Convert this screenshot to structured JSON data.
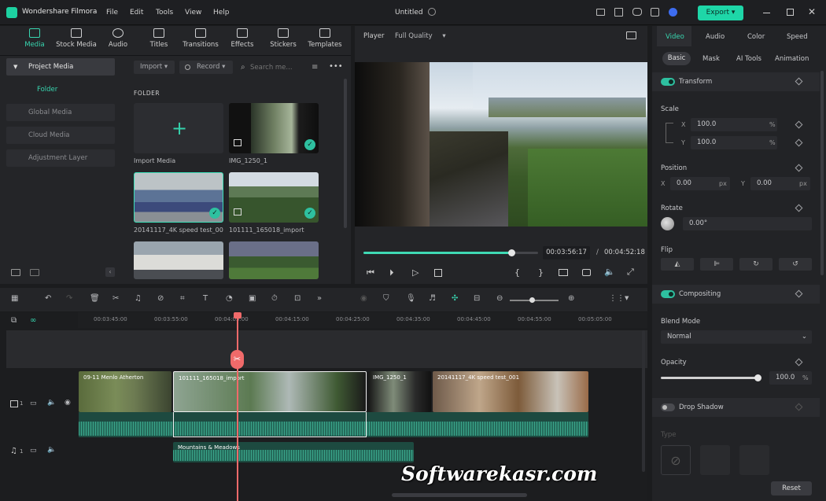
{
  "app": {
    "name": "Wondershare Filmora",
    "doc_title": "Untitled",
    "export_label": "Export",
    "menu": [
      "File",
      "Edit",
      "Tools",
      "View",
      "Help"
    ]
  },
  "toolbar": {
    "tabs": [
      "Media",
      "Stock Media",
      "Audio",
      "Titles",
      "Transitions",
      "Effects",
      "Stickers",
      "Templates"
    ]
  },
  "sidebar": {
    "items": [
      "Project Media",
      "Folder",
      "Global Media",
      "Cloud Media",
      "Adjustment Layer"
    ]
  },
  "media": {
    "import_label": "Import",
    "record_label": "Record",
    "search_placeholder": "Search me...",
    "folder_label": "FOLDER",
    "items": [
      "Import Media",
      "IMG_1250_1",
      "20141117_4K speed test_00...",
      "101111_165018_import"
    ]
  },
  "player": {
    "label": "Player",
    "quality": "Full Quality",
    "current_time": "00:03:56:17",
    "separator": "/",
    "total_time": "00:04:52:18",
    "progress": 0.85
  },
  "props": {
    "tabs": [
      "Video",
      "Audio",
      "Color",
      "Speed"
    ],
    "subtabs": [
      "Basic",
      "Mask",
      "AI Tools",
      "Animation"
    ],
    "transform": "Transform",
    "scale": "Scale",
    "scale_x": "100.0",
    "scale_y": "100.0",
    "pct": "%",
    "position": "Position",
    "pos_x": "0.00",
    "pos_y": "0.00",
    "px": "px",
    "x": "X",
    "y": "Y",
    "rotate": "Rotate",
    "rotate_val": "0.00°",
    "flip": "Flip",
    "compositing": "Compositing",
    "blend_mode": "Blend Mode",
    "blend_val": "Normal",
    "opacity": "Opacity",
    "opacity_val": "100.0",
    "drop_shadow": "Drop Shadow",
    "type": "Type",
    "reset": "Reset"
  },
  "timeline": {
    "ticks": [
      "00:03:45:00",
      "00:03:55:00",
      "00:04:05:00",
      "00:04:15:00",
      "00:04:25:00",
      "00:04:35:00",
      "00:04:45:00",
      "00:04:55:00",
      "00:05:05:00"
    ],
    "clips": [
      "09-11 Menlo Atherton",
      "101111_165018_import",
      "IMG_1250_1",
      "20141117_4K speed test_001"
    ],
    "audio_clip": "Mountains & Meadows",
    "track1": "1",
    "track2": "1"
  },
  "watermark": "Softwarekasr.com",
  "colors": {
    "accent": "#1ed6a8",
    "bg": "#1b1c1e",
    "playhead": "#f06a6a"
  }
}
